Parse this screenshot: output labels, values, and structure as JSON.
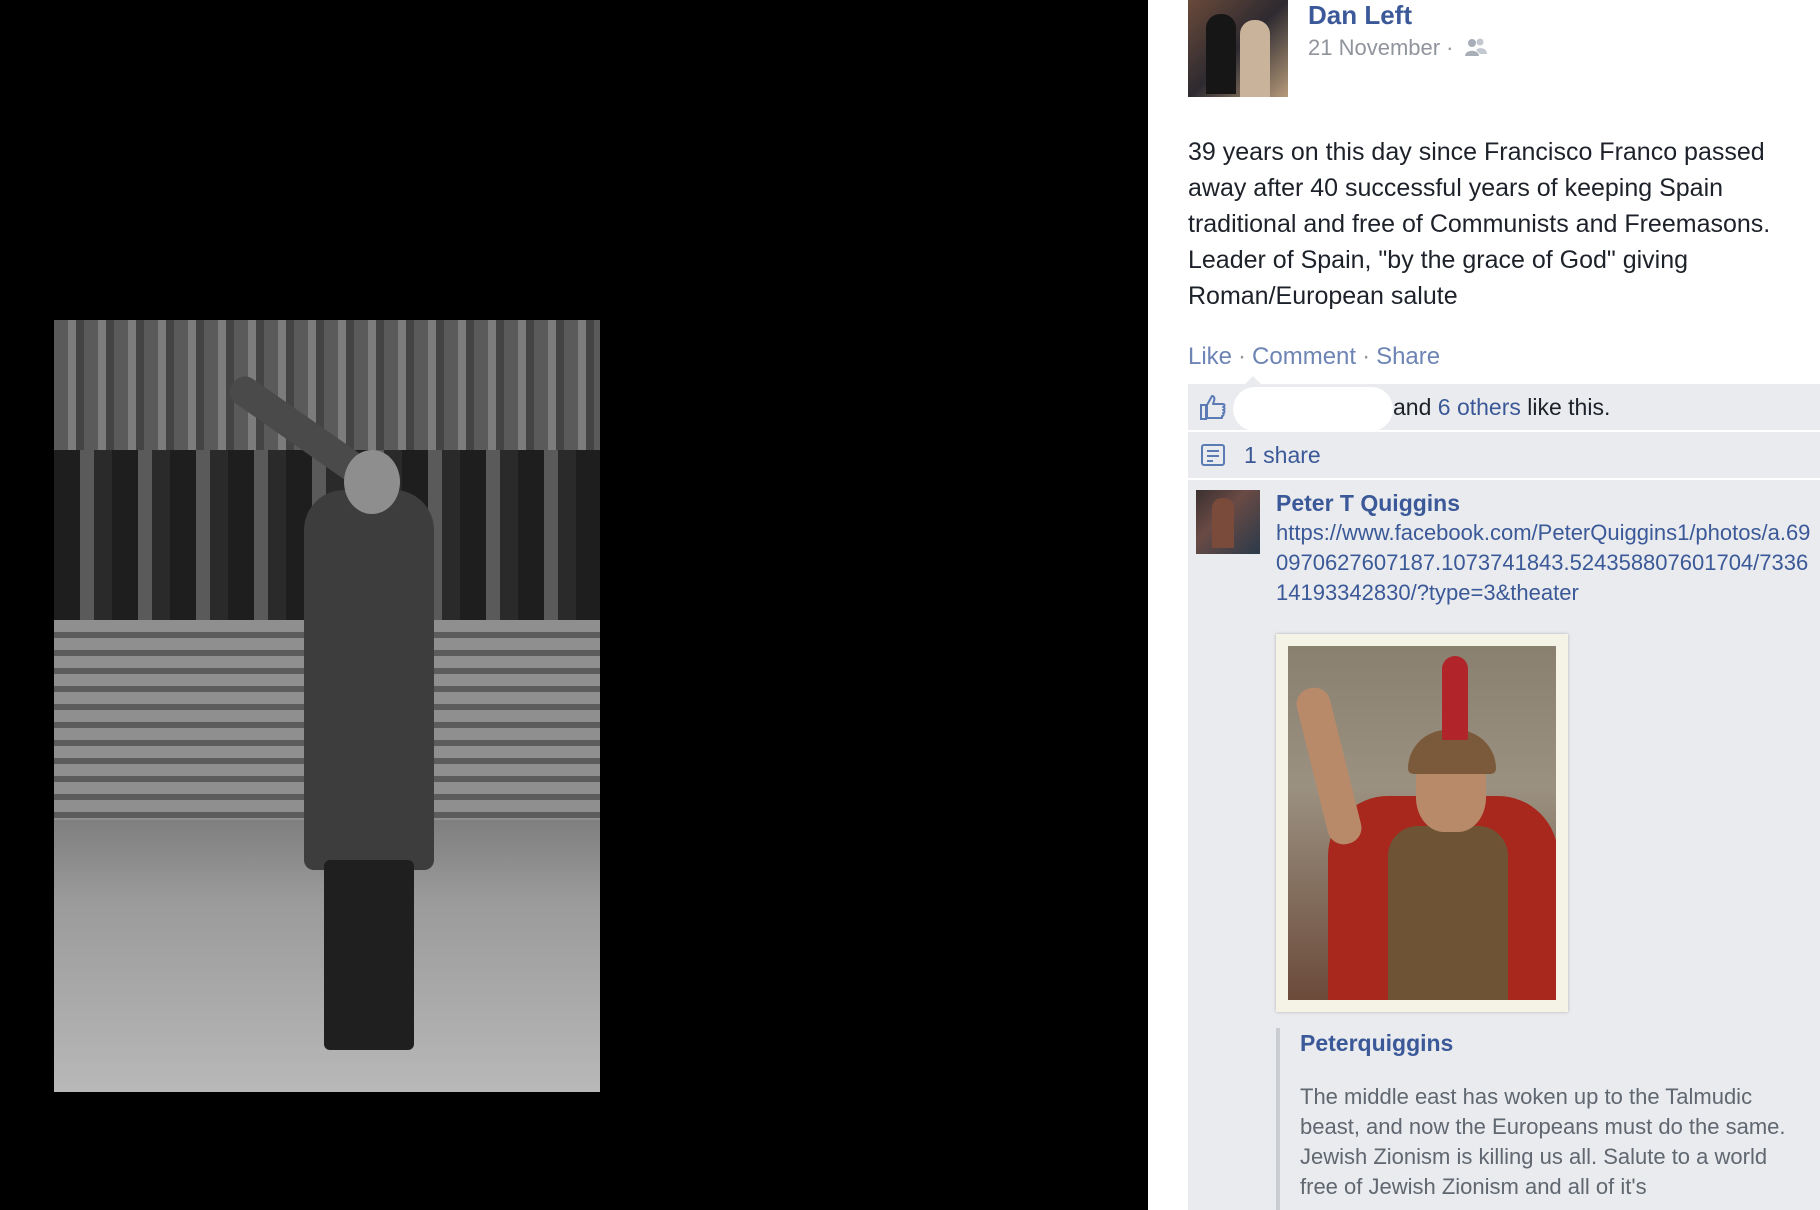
{
  "post": {
    "author": "Dan Left",
    "date": "21 November ·",
    "audience_icon": "friends-icon",
    "text": "39 years on this day since Francisco Franco passed away after 40 successful years of keeping Spain traditional and free of Communists and Freemasons. Leader of Spain, \"by the grace of God\" giving Roman/European salute",
    "actions": {
      "like": "Like",
      "comment": "Comment",
      "share": "Share",
      "sep": "·"
    }
  },
  "feedback": {
    "likes": {
      "and": "and",
      "others_link": "6 others",
      "suffix": "like this."
    },
    "shares": "1 share"
  },
  "comment": {
    "author": "Peter T Quiggins",
    "link": "https://www.facebook.com/PeterQuiggins1/photos/a.690970627607187.1073741843.524358807601704/733614193342830/?type=3&theater",
    "shared_author": "Peterquiggins",
    "shared_text": "The middle east has woken up to the Talmudic beast, and now the Europeans must do the same. Jewish Zionism is killing us all. Salute to a world free of Jewish Zionism and all of it's"
  },
  "colors": {
    "link": "#3b5998",
    "text": "#1d2129",
    "muted": "#90949c",
    "feedback_bg": "#e9ebee"
  }
}
